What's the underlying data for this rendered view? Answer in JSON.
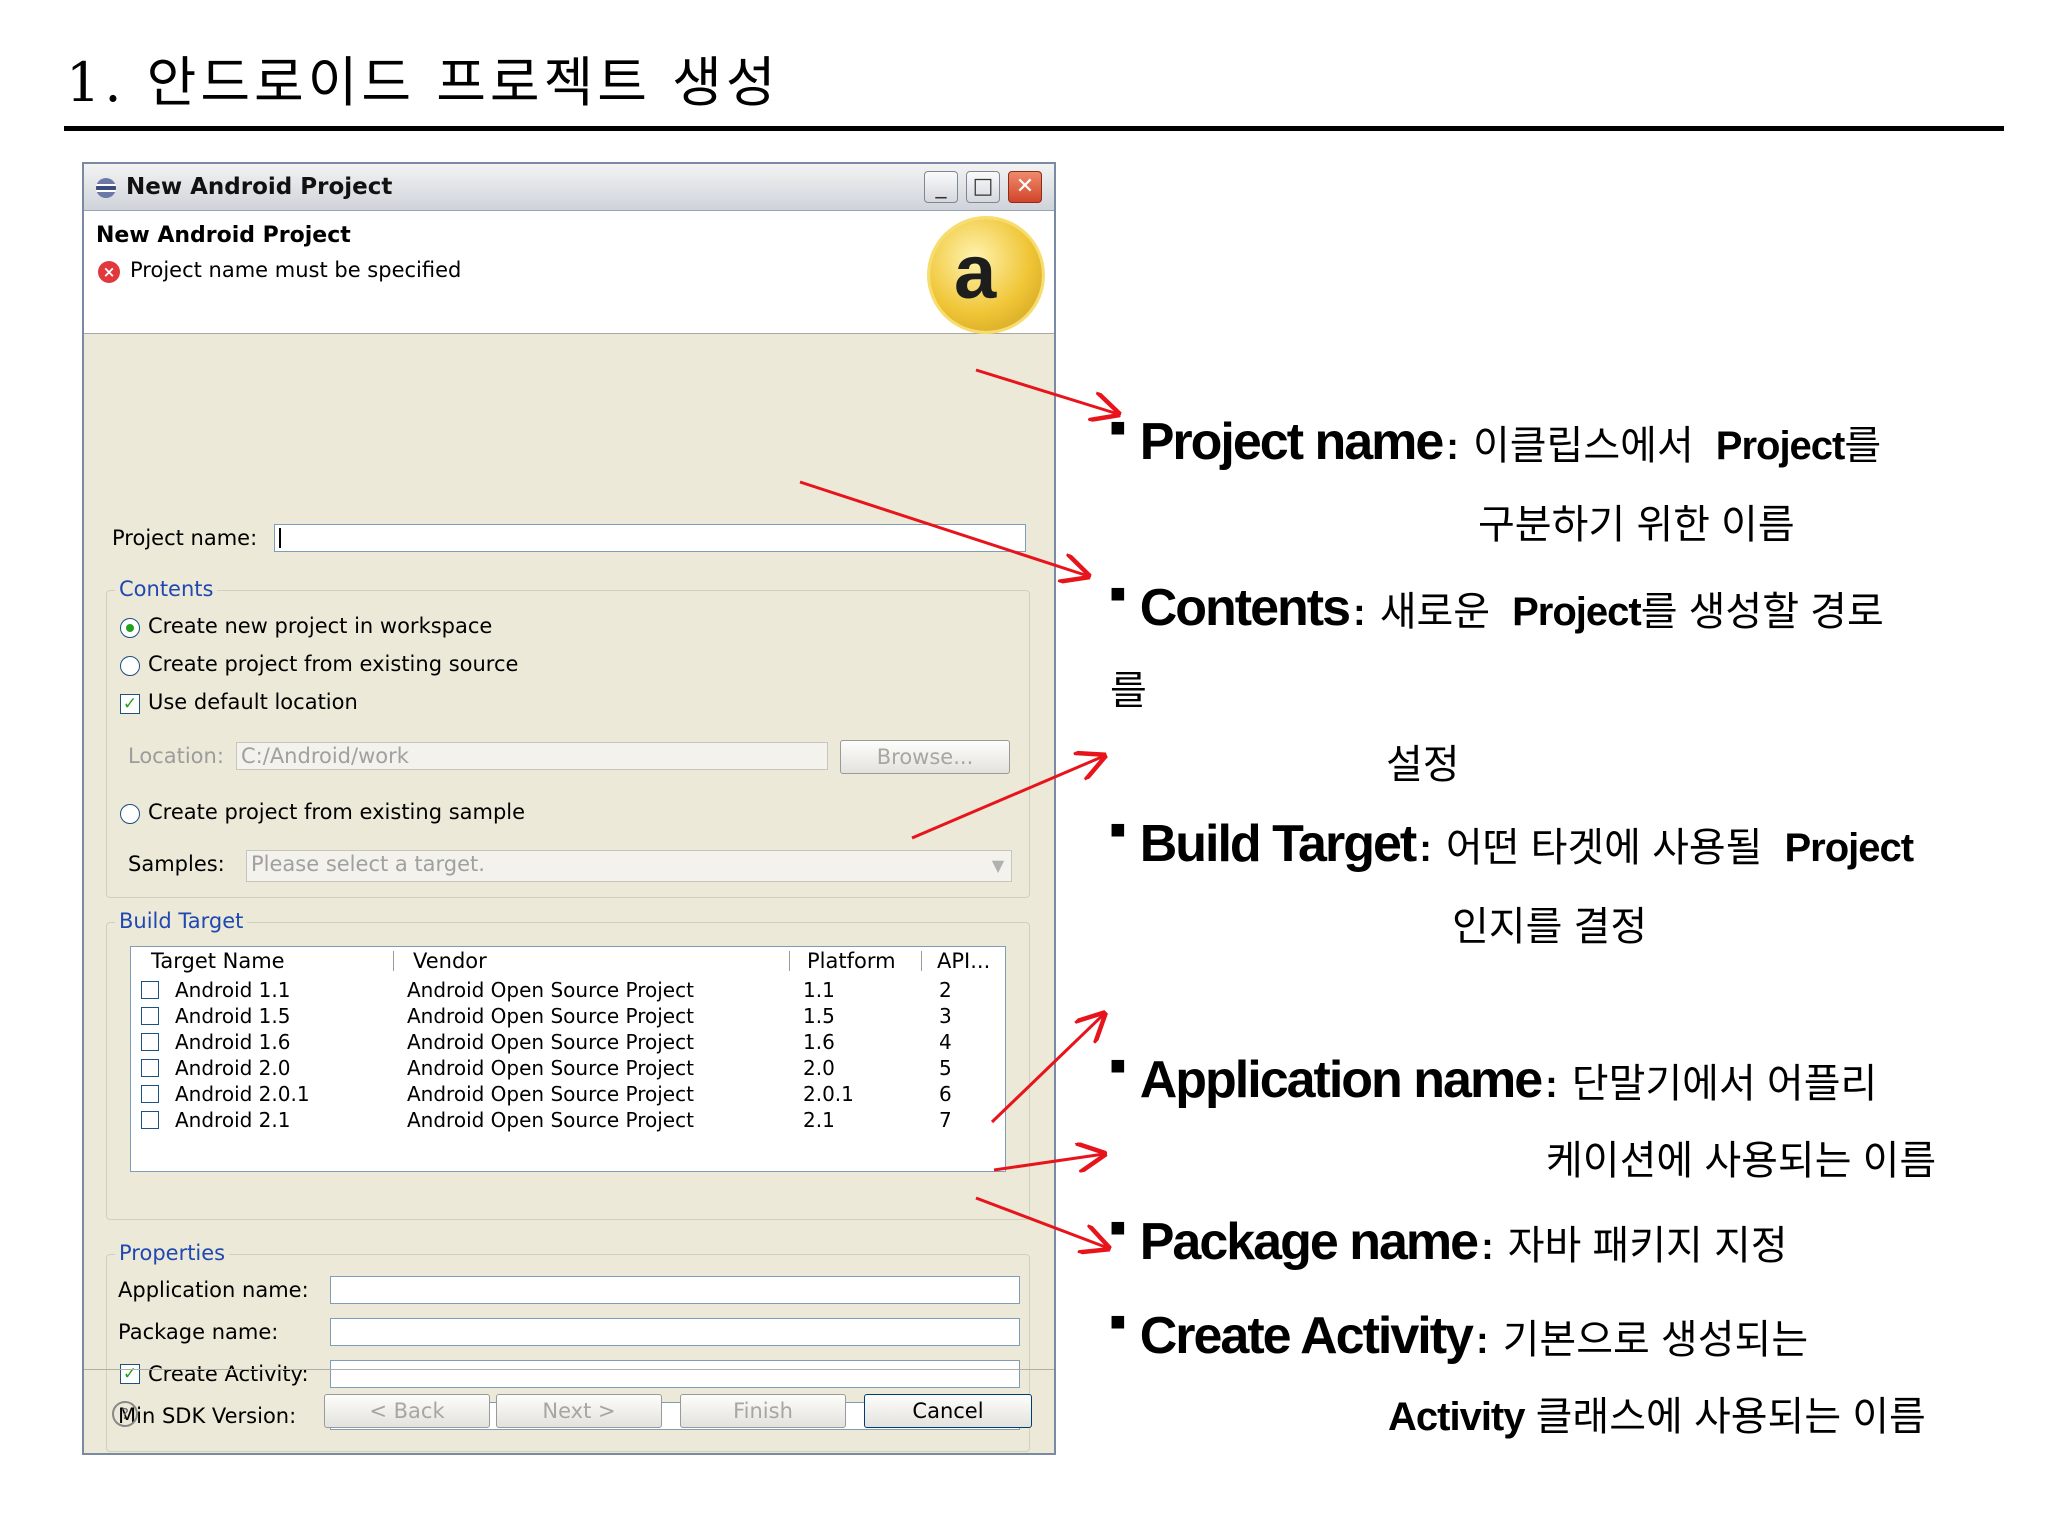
{
  "slide": {
    "title": "1. 안드로이드 프로젝트 생성"
  },
  "dialog": {
    "window_title": "New Android Project",
    "header_title": "New Android Project",
    "error_message": "Project name must be specified",
    "project_name_label": "Project name:",
    "project_name_value": "",
    "contents": {
      "group_label": "Contents",
      "radio_new": "Create new project in workspace",
      "radio_existing": "Create project from existing source",
      "use_default_location": "Use default location",
      "location_label": "Location:",
      "location_value": "C:/Android/work",
      "browse_label": "Browse...",
      "radio_sample": "Create project from existing sample",
      "samples_label": "Samples:",
      "samples_value": "Please select a target."
    },
    "build_target": {
      "group_label": "Build Target",
      "columns": [
        "Target Name",
        "Vendor",
        "Platform",
        "API..."
      ],
      "rows": [
        {
          "name": "Android 1.1",
          "vendor": "Android Open Source Project",
          "platform": "1.1",
          "api": "2"
        },
        {
          "name": "Android 1.5",
          "vendor": "Android Open Source Project",
          "platform": "1.5",
          "api": "3"
        },
        {
          "name": "Android 1.6",
          "vendor": "Android Open Source Project",
          "platform": "1.6",
          "api": "4"
        },
        {
          "name": "Android 2.0",
          "vendor": "Android Open Source Project",
          "platform": "2.0",
          "api": "5"
        },
        {
          "name": "Android 2.0.1",
          "vendor": "Android Open Source Project",
          "platform": "2.0.1",
          "api": "6"
        },
        {
          "name": "Android 2.1",
          "vendor": "Android Open Source Project",
          "platform": "2.1",
          "api": "7"
        }
      ]
    },
    "properties": {
      "group_label": "Properties",
      "application_name_label": "Application name:",
      "package_name_label": "Package name:",
      "create_activity_label": "Create Activity:",
      "min_sdk_label": "Min SDK Version:"
    },
    "buttons": {
      "back": "< Back",
      "next": "Next >",
      "finish": "Finish",
      "cancel": "Cancel"
    }
  },
  "annotations": {
    "project_name": {
      "keyword": "Project name",
      "desc": "이클립스에서",
      "desc_kw": "Project",
      "desc_tail": "를",
      "cont": "구분하기 위한 이름"
    },
    "contents": {
      "keyword": "Contents",
      "desc_kw": "Project",
      "desc_pre": "새로운",
      "desc_tail": "를 생성할 경로",
      "cont1": "를",
      "cont2": "설정"
    },
    "build_target": {
      "keyword": "Build Target",
      "desc": "어떤 타겟에 사용될",
      "desc_kw": "Project",
      "cont": "인지를 결정"
    },
    "application_name": {
      "keyword": "Application name",
      "desc": "단말기에서 어플리",
      "cont": "케이션에 사용되는 이름"
    },
    "package_name": {
      "keyword": "Package name",
      "desc": "자바 패키지 지정"
    },
    "create_activity": {
      "keyword": "Create Activity",
      "desc": "기본으로 생성되는",
      "cont_kw": "Activity",
      "cont": "클래스에 사용되는 이름"
    }
  },
  "colors": {
    "arrow": "#e8141c",
    "group_title": "#1f48b0",
    "dialog_bg": "#ece9d8"
  }
}
